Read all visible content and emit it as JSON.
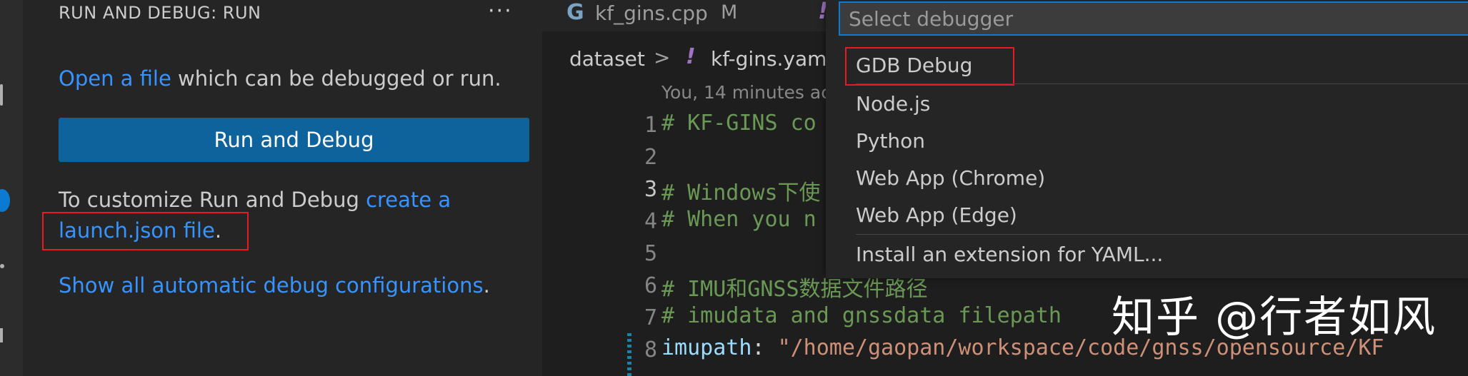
{
  "sidebar": {
    "title": "RUN AND DEBUG: RUN",
    "more_actions": "···",
    "open_file_link": "Open a file",
    "open_file_rest": " which can be debugged or run.",
    "run_button_label": "Run and Debug",
    "customize_text": "To customize Run and Debug ",
    "create_link_part1": "create a",
    "create_link_part2": "launch.json file",
    "period": ".",
    "show_all_link": "Show all automatic debug configurations"
  },
  "editor": {
    "tabs": [
      {
        "label": "kf_gins.cpp",
        "status": "M"
      }
    ],
    "breadcrumb": {
      "folder": "dataset",
      "separator": ">",
      "file": "kf-gins.yam"
    },
    "blame": "You, 14 minutes ac",
    "lines": [
      {
        "num": "1",
        "text": "# KF-GINS co"
      },
      {
        "num": "2",
        "text": ""
      },
      {
        "num": "3",
        "text": "# Windows下使"
      },
      {
        "num": "4",
        "text": "# When you n"
      },
      {
        "num": "5",
        "text": ""
      },
      {
        "num": "6",
        "text": "# IMU和GNSS数据文件路径"
      },
      {
        "num": "7",
        "text": "# imudata and gnssdata filepath"
      },
      {
        "num": "8",
        "key": "imupath",
        "colon": ": ",
        "value": "\"/home/gaopan/workspace/code/gnss/opensource/KF"
      }
    ]
  },
  "quick_pick": {
    "placeholder": "Select debugger",
    "items": [
      {
        "label": "GDB Debug"
      },
      {
        "label": "Node.js"
      },
      {
        "label": "Python"
      },
      {
        "label": "Web App (Chrome)"
      },
      {
        "label": "Web App (Edge)"
      },
      {
        "label": "Install an extension for YAML..."
      }
    ]
  },
  "watermark": "知乎 @行者如风",
  "colors": {
    "accent": "#0e639c",
    "link": "#3794ff",
    "focus_border": "#0e7ad2",
    "highlight_box": "#e51c23"
  }
}
